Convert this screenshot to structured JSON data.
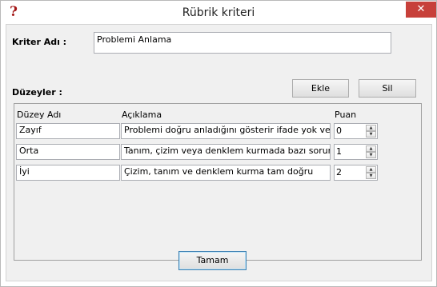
{
  "window": {
    "title": "Rübrik kriteri",
    "close_glyph": "✕",
    "app_icon_glyph": "?"
  },
  "criterion": {
    "label": "Kriter Adı :",
    "value": "Problemi Anlama"
  },
  "levels": {
    "label": "Düzeyler :",
    "add_label": "Ekle",
    "delete_label": "Sil",
    "columns": {
      "name": "Düzey Adı",
      "description": "Açıklama",
      "points": "Puan"
    },
    "rows": [
      {
        "name": "Zayıf",
        "description": "Problemi doğru anladığını gösterir ifade yok veya hatalı",
        "points": "0"
      },
      {
        "name": "Orta",
        "description": "Tanım, çizim veya denklem kurmada bazı sorunlar var",
        "points": "1"
      },
      {
        "name": "İyi",
        "description": "Çizim, tanım ve denklem kurma tam doğru",
        "points": "2"
      }
    ]
  },
  "footer": {
    "ok_label": "Tamam"
  },
  "icons": {
    "spin_up": "▲",
    "spin_down": "▼"
  }
}
